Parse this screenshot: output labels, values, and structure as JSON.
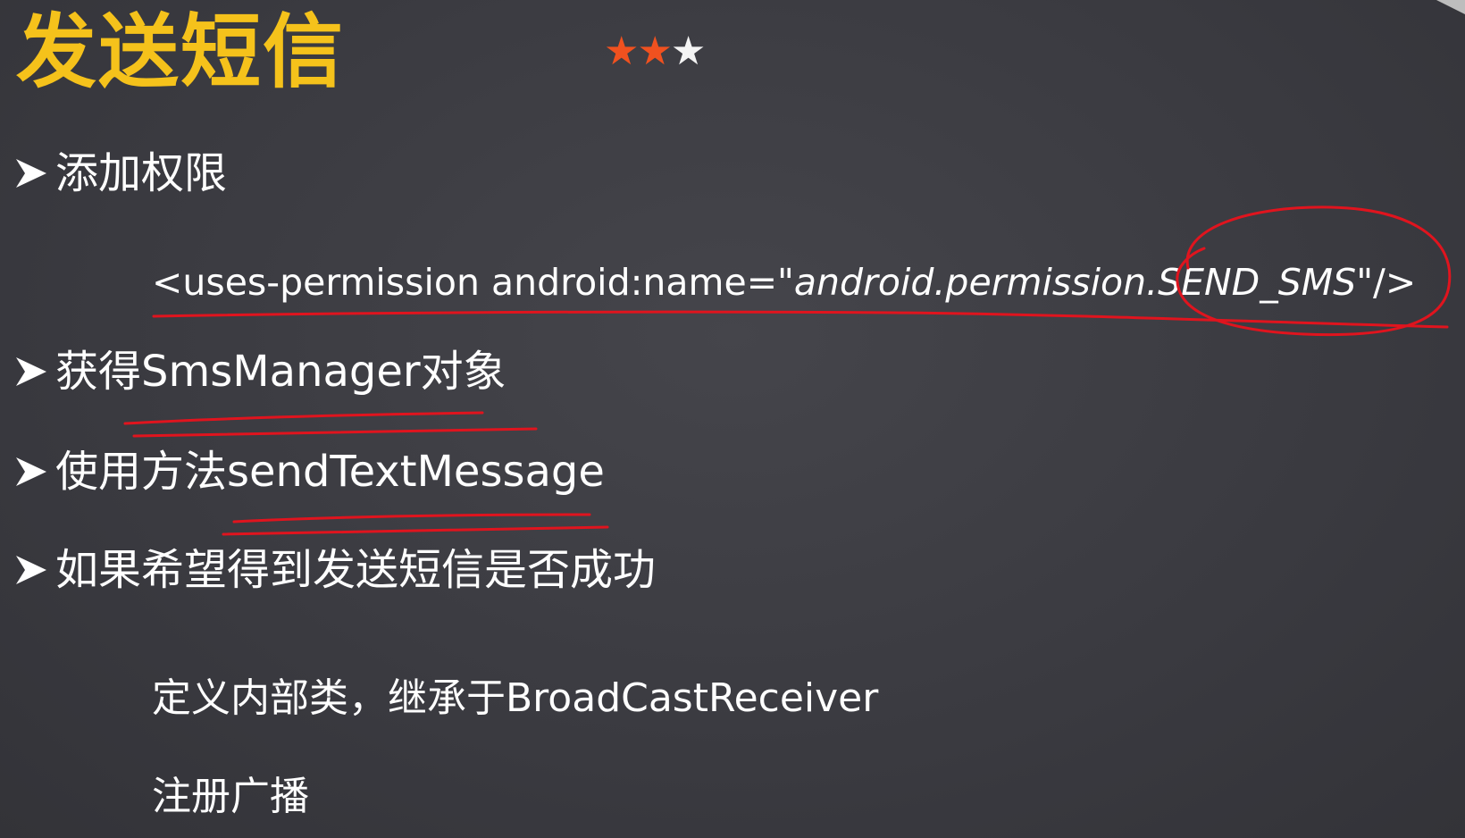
{
  "slide": {
    "title": "发送短信",
    "difficulty": {
      "rating": 2,
      "max": 3
    },
    "bullets": [
      {
        "text": "添加权限"
      },
      {
        "text": "获得SmsManager对象"
      },
      {
        "text": "使用方法sendTextMessage"
      },
      {
        "text": "如果希望得到发送短信是否成功"
      }
    ],
    "code": {
      "prefix": "<uses-permission  android:name=\"",
      "italic": "android.permission.SEND_SMS",
      "suffix": "\"/>"
    },
    "sub_items": [
      "定义内部类，继承于BroadCastReceiver",
      "注册广播"
    ]
  },
  "colors": {
    "background": "#3c3c42",
    "title": "#f5c21b",
    "star_filled": "#f0511f",
    "star_empty": "#f4f4f4",
    "annotation": "#e0141e",
    "text": "#ffffff"
  },
  "icons": {
    "bullet": "arrow-bullet-icon",
    "rating": "star-icon"
  }
}
